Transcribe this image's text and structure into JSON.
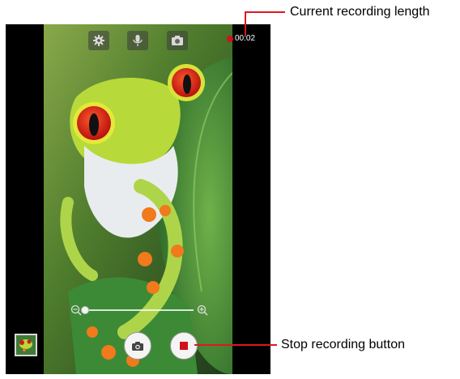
{
  "camera": {
    "recording_time": "00:02",
    "top_controls": [
      {
        "name": "settings-icon"
      },
      {
        "name": "microphone-icon"
      },
      {
        "name": "switch-camera-icon"
      }
    ],
    "zoom_level": 0.0,
    "accent_color": "#d0121b"
  },
  "annotations": {
    "recording_length_label": "Current recording length",
    "stop_button_label": "Stop recording button",
    "callout_color": "#e2161f"
  }
}
